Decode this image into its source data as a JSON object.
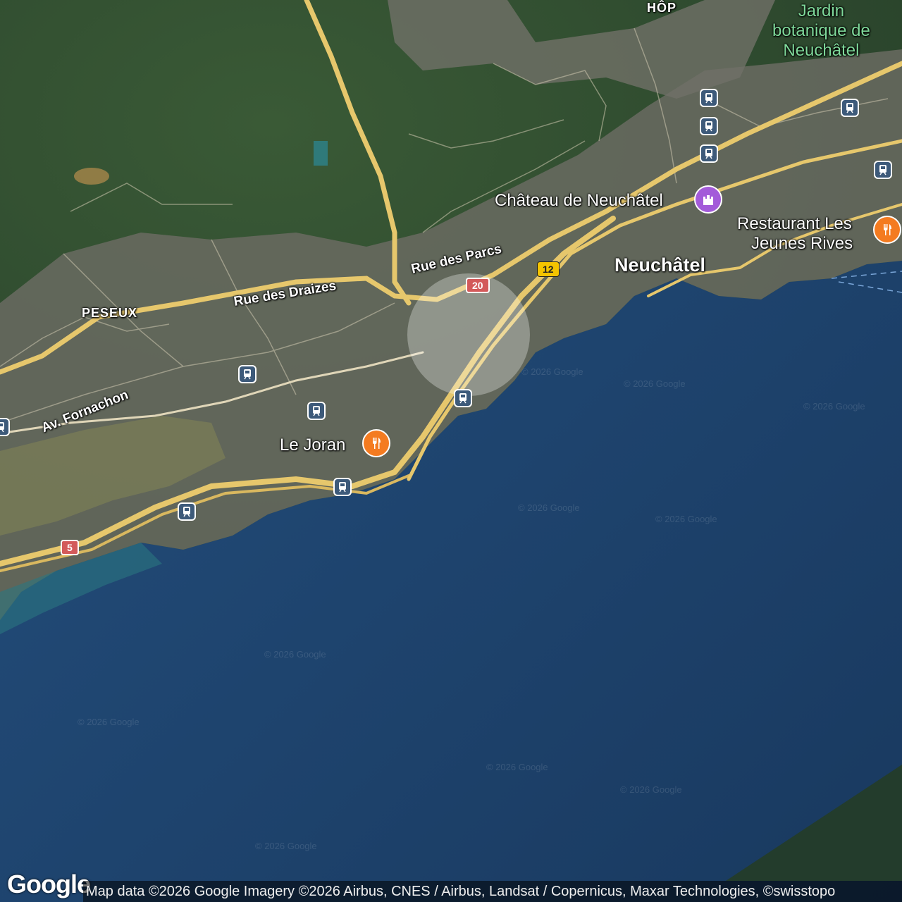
{
  "map": {
    "place_labels": {
      "neuchatel": "Neuchâtel",
      "peseux": "PESEUX",
      "hop": "HÔP"
    },
    "road_labels": {
      "rue_des_draizes": "Rue des Draizes",
      "rue_des_parcs": "Rue des Parcs",
      "av_fornachon": "Av. Fornachon"
    },
    "poi": {
      "chateau": "Château de Neuchâtel",
      "restaurant_jeunes_rives_line1": "Restaurant Les",
      "restaurant_jeunes_rives_line2": "Jeunes Rives",
      "le_joran": "Le Joran",
      "jardin_line1": "Jardin",
      "jardin_line2": "botanique de",
      "jardin_line3": "Neuchâtel"
    },
    "shields": {
      "route_20": "20",
      "route_12": "12",
      "route_5": "5"
    },
    "icons": {
      "train": "train-station-icon",
      "restaurant": "fork-knife-icon",
      "castle": "castle-icon"
    },
    "watermark": "© 2026 Google",
    "attribution": "Map data ©2026 Google Imagery ©2026 Airbus, CNES / Airbus, Landsat / Copernicus, Maxar Technologies, ©swisstopo",
    "logo": "Google",
    "colors": {
      "lake": "#1d4270",
      "forest": "#2f4a2c",
      "urban": "#6d6e68",
      "road_major": "#e6c76c",
      "restaurant_marker": "#f47b20",
      "castle_marker": "#a35bd9"
    }
  }
}
